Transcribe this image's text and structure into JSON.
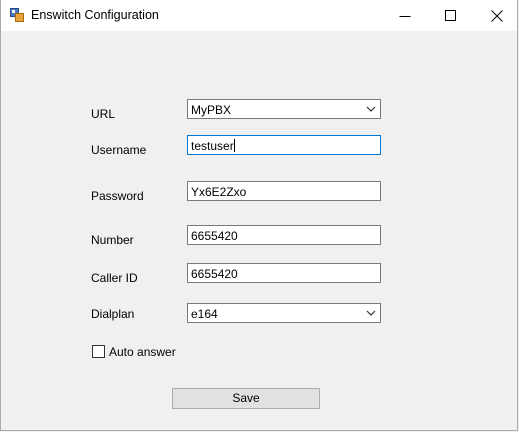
{
  "window": {
    "title": "Enswitch Configuration"
  },
  "form": {
    "url": {
      "label": "URL",
      "value": "MyPBX"
    },
    "username": {
      "label": "Username",
      "value": "testuser"
    },
    "password": {
      "label": "Password",
      "value": "Yx6E2Zxo"
    },
    "number": {
      "label": "Number",
      "value": "6655420"
    },
    "caller_id": {
      "label": "Caller ID",
      "value": "6655420"
    },
    "dialplan": {
      "label": "Dialplan",
      "value": "e164"
    },
    "auto_answer": {
      "label": "Auto answer",
      "checked": false
    },
    "save_label": "Save"
  },
  "colors": {
    "focus_border": "#0078d7",
    "window_bg": "#f0f0f0"
  },
  "icons": [
    "app-icon",
    "minimize-icon",
    "maximize-icon",
    "close-icon",
    "chevron-down-icon"
  ]
}
